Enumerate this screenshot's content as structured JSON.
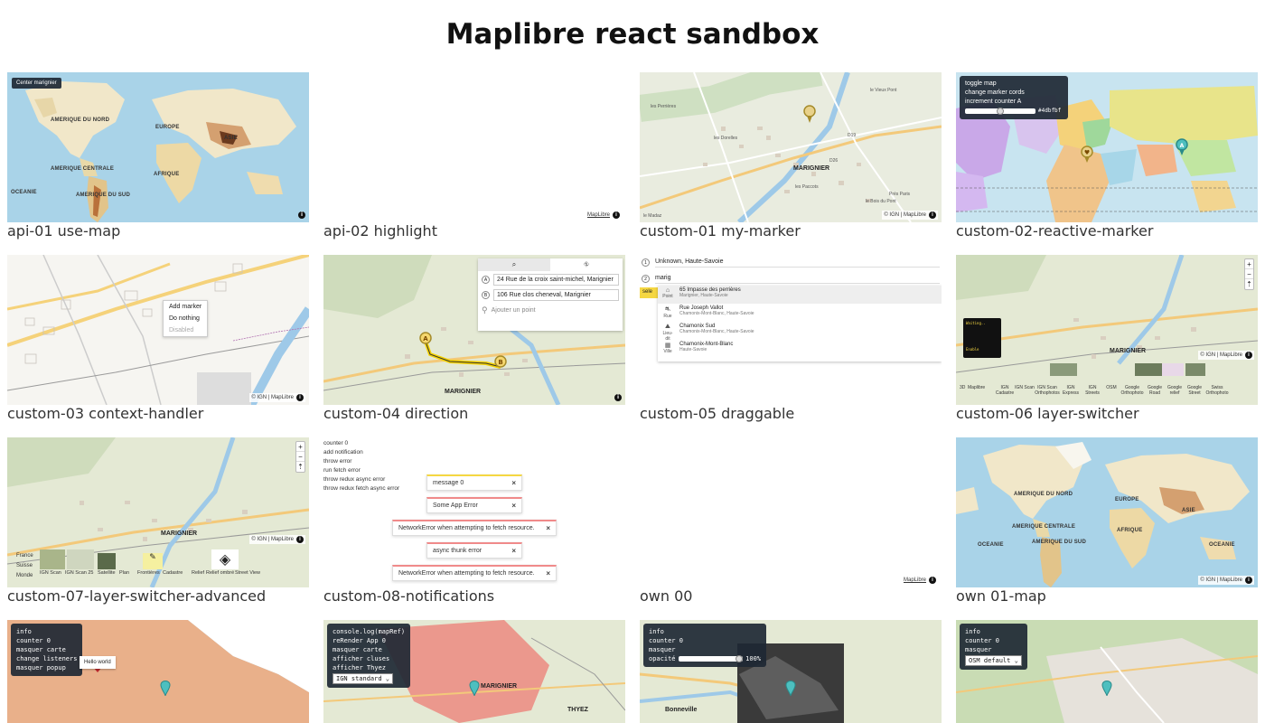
{
  "page": {
    "title": "Maplibre react sandbox"
  },
  "common": {
    "attribution": "MapLibre",
    "attribution_ign": "© IGN | MapLibre",
    "info": "i"
  },
  "cards": {
    "api01": {
      "caption": "api-01 use-map",
      "button": "Center marignier",
      "labels": {
        "north_america": "AMERIQUE DU NORD",
        "central_america": "AMERIQUE CENTRALE",
        "south_america": "AMERIQUE DU SUD",
        "europe": "EUROPE",
        "asia": "ASIE",
        "africa": "AFRIQUE",
        "oceania": "OCEANIE"
      }
    },
    "api02": {
      "caption": "api-02 highlight"
    },
    "custom01": {
      "caption": "custom-01 my-marker",
      "town": "MARIGNIER",
      "streets": [
        "les Perrières",
        "le Vieux Pont",
        "les Dorelles",
        "les Paccots",
        "Prés Paris",
        "le Bois du Pont",
        "le Madaz",
        "D19",
        "D26"
      ]
    },
    "custom02": {
      "caption": "custom-02-reactive-marker",
      "menu": [
        "toggle map",
        "change marker cords",
        "increment counter A"
      ],
      "color_value": "#4dbfbf"
    },
    "custom03": {
      "caption": "custom-03 context-handler",
      "menu": [
        "Add marker",
        "Do nothing",
        "Disabled"
      ]
    },
    "custom04": {
      "caption": "custom-04 direction",
      "town": "MARIGNIER",
      "waypoints": [
        {
          "letter": "A",
          "address": "24 Rue de la croix saint-michel, Marignier"
        },
        {
          "letter": "B",
          "address": "106 Rue clos cheneval, Marignier"
        }
      ],
      "add_point": "Ajouter un point",
      "tabs": [
        "search-tab",
        "route-tab"
      ]
    },
    "custom05": {
      "caption": "custom-05 draggable",
      "field1": "Unknown, Haute-Savoie",
      "field2": "marig",
      "select_label": "sele",
      "results": [
        {
          "name": "65 Impasse des perrières",
          "sub": "Marignier, Haute-Savoie",
          "type": "Point"
        },
        {
          "name": "Rue Joseph Vallot",
          "sub": "Chamonix-Mont-Blanc, Haute-Savoie",
          "type": "Rue"
        },
        {
          "name": "Chamonix Sud",
          "sub": "Chamonix-Mont-Blanc, Haute-Savoie",
          "type": "Lieu-dit"
        },
        {
          "name": "Chamonix-Mont-Blanc",
          "sub": "Haute-Savoie",
          "type": "Ville"
        }
      ]
    },
    "custom06": {
      "caption": "custom-06 layer-switcher",
      "town": "MARIGNIER",
      "panel": [
        "Waiting..",
        "Enable"
      ],
      "layers": [
        "3D",
        "Maplibre",
        "IGN Cadastre",
        "IGN Scan",
        "IGN Scan Orthophotos",
        "IGN Express",
        "IGN Streets",
        "OSM",
        "Google Orthophoto",
        "Google Road",
        "Google relief",
        "Google Street",
        "Swiss Orthophoto"
      ]
    },
    "custom07": {
      "caption": "custom-07-layer-switcher-advanced",
      "town": "MARIGNIER",
      "countries": [
        "France",
        "Suisse",
        "Monde"
      ],
      "layers": [
        "IGN Scan",
        "IGN Scan 25",
        "Satellite",
        "Plan",
        "Frontières",
        "Cadastre",
        "Relief",
        "Relief ombré",
        "Street View"
      ]
    },
    "custom08": {
      "caption": "custom-08-notifications",
      "menu": [
        "counter 0",
        "add notification",
        "throw error",
        "run fetch error",
        "throw redux async error",
        "throw redux fetch async error"
      ],
      "notifications": [
        {
          "text": "message 0",
          "kind": "yellow"
        },
        {
          "text": "Some App Error",
          "kind": "red"
        },
        {
          "text": "NetworkError when attempting to fetch resource.",
          "kind": "red"
        },
        {
          "text": "async thunk error",
          "kind": "red"
        },
        {
          "text": "NetworkError when attempting to fetch resource.",
          "kind": "red"
        }
      ]
    },
    "own00": {
      "caption": "own 00"
    },
    "own01": {
      "caption": "own 01-map",
      "labels": {
        "north_america": "AMERIQUE DU NORD",
        "central_america": "AMERIQUE CENTRALE",
        "south_america": "AMERIQUE DU SUD",
        "europe": "EUROPE",
        "asia": "ASIE",
        "africa": "AFRIQUE",
        "oceania": "OCEANIE",
        "oceania2": "OCEANIE"
      }
    },
    "own02": {
      "menu": [
        "info",
        "counter 0",
        "masquer carte",
        "change listeners",
        "masquer popup"
      ],
      "popup": "Hello world"
    },
    "own03": {
      "menu": [
        "console.log(mapRef)",
        "reRender App 0",
        "masquer carte",
        "afficher cluses",
        "afficher Thyez"
      ],
      "select": "IGN standard",
      "town": "MARIGNIER",
      "town2": "THYEZ"
    },
    "own04": {
      "menu": [
        "info",
        "counter 0",
        "masquer"
      ],
      "opacity_label": "opacité",
      "opacity_value": "100%",
      "opacity_fraction": 1.0,
      "town": "Bonneville"
    },
    "own05": {
      "menu": [
        "info",
        "counter 0",
        "masquer"
      ],
      "select": "OSM default"
    }
  }
}
